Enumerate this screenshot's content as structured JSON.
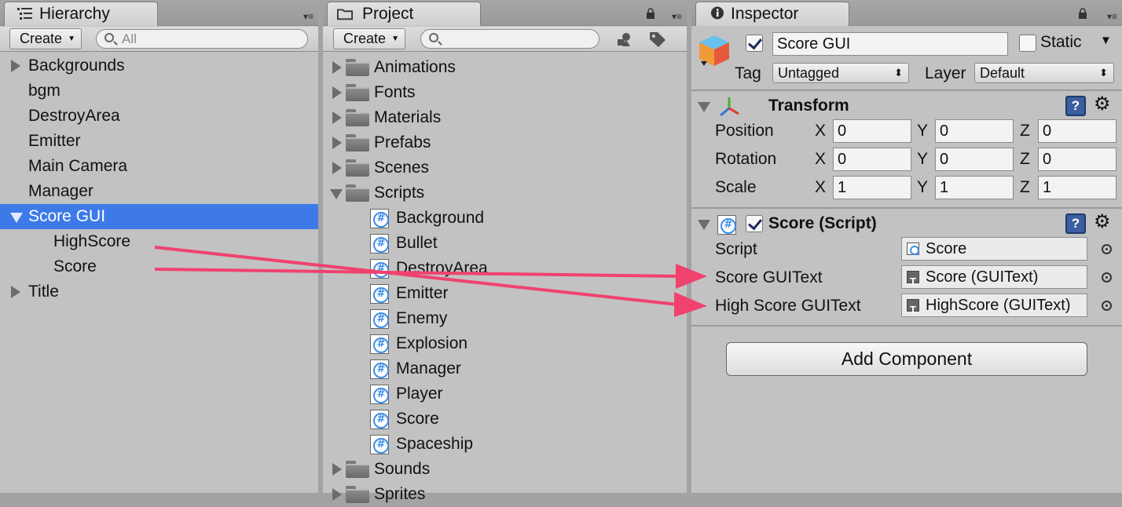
{
  "hierarchy": {
    "tab_title": "Hierarchy",
    "create_label": "Create",
    "search_placeholder": "All",
    "items": [
      {
        "label": "Backgrounds",
        "expand": "right",
        "indent": 0
      },
      {
        "label": "bgm",
        "expand": "none",
        "indent": 0
      },
      {
        "label": "DestroyArea",
        "expand": "none",
        "indent": 0
      },
      {
        "label": "Emitter",
        "expand": "none",
        "indent": 0
      },
      {
        "label": "Main Camera",
        "expand": "none",
        "indent": 0
      },
      {
        "label": "Manager",
        "expand": "none",
        "indent": 0
      },
      {
        "label": "Score GUI",
        "expand": "down",
        "indent": 0,
        "selected": true
      },
      {
        "label": "HighScore",
        "expand": "none",
        "indent": 1
      },
      {
        "label": "Score",
        "expand": "none",
        "indent": 1
      },
      {
        "label": "Title",
        "expand": "right",
        "indent": 0
      }
    ]
  },
  "project": {
    "tab_title": "Project",
    "create_label": "Create",
    "search_placeholder": "",
    "items": [
      {
        "label": "Animations",
        "kind": "folder",
        "expand": "right"
      },
      {
        "label": "Fonts",
        "kind": "folder",
        "expand": "right"
      },
      {
        "label": "Materials",
        "kind": "folder",
        "expand": "right"
      },
      {
        "label": "Prefabs",
        "kind": "folder",
        "expand": "right"
      },
      {
        "label": "Scenes",
        "kind": "folder",
        "expand": "right"
      },
      {
        "label": "Scripts",
        "kind": "folder",
        "expand": "down"
      },
      {
        "label": "Background",
        "kind": "script"
      },
      {
        "label": "Bullet",
        "kind": "script"
      },
      {
        "label": "DestroyArea",
        "kind": "script"
      },
      {
        "label": "Emitter",
        "kind": "script"
      },
      {
        "label": "Enemy",
        "kind": "script"
      },
      {
        "label": "Explosion",
        "kind": "script"
      },
      {
        "label": "Manager",
        "kind": "script"
      },
      {
        "label": "Player",
        "kind": "script"
      },
      {
        "label": "Score",
        "kind": "script"
      },
      {
        "label": "Spaceship",
        "kind": "script"
      },
      {
        "label": "Sounds",
        "kind": "folder",
        "expand": "right"
      },
      {
        "label": "Sprites",
        "kind": "folder",
        "expand": "right"
      }
    ]
  },
  "inspector": {
    "tab_title": "Inspector",
    "object_name": "Score GUI",
    "static_label": "Static",
    "tag_label": "Tag",
    "tag_value": "Untagged",
    "layer_label": "Layer",
    "layer_value": "Default",
    "transform": {
      "title": "Transform",
      "rows": [
        {
          "label": "Position",
          "x": "0",
          "y": "0",
          "z": "0"
        },
        {
          "label": "Rotation",
          "x": "0",
          "y": "0",
          "z": "0"
        },
        {
          "label": "Scale",
          "x": "1",
          "y": "1",
          "z": "1"
        }
      ],
      "axis_x": "X",
      "axis_y": "Y",
      "axis_z": "Z"
    },
    "script_component": {
      "title": "Score (Script)",
      "script_label": "Script",
      "script_value": "Score",
      "score_label": "Score GUIText",
      "score_value": "Score (GUIText)",
      "highscore_label": "High Score GUIText",
      "highscore_value": "HighScore (GUIText)"
    },
    "add_component_label": "Add Component"
  },
  "colors": {
    "selection": "#3d7ae8",
    "arrow": "#f0426e"
  }
}
